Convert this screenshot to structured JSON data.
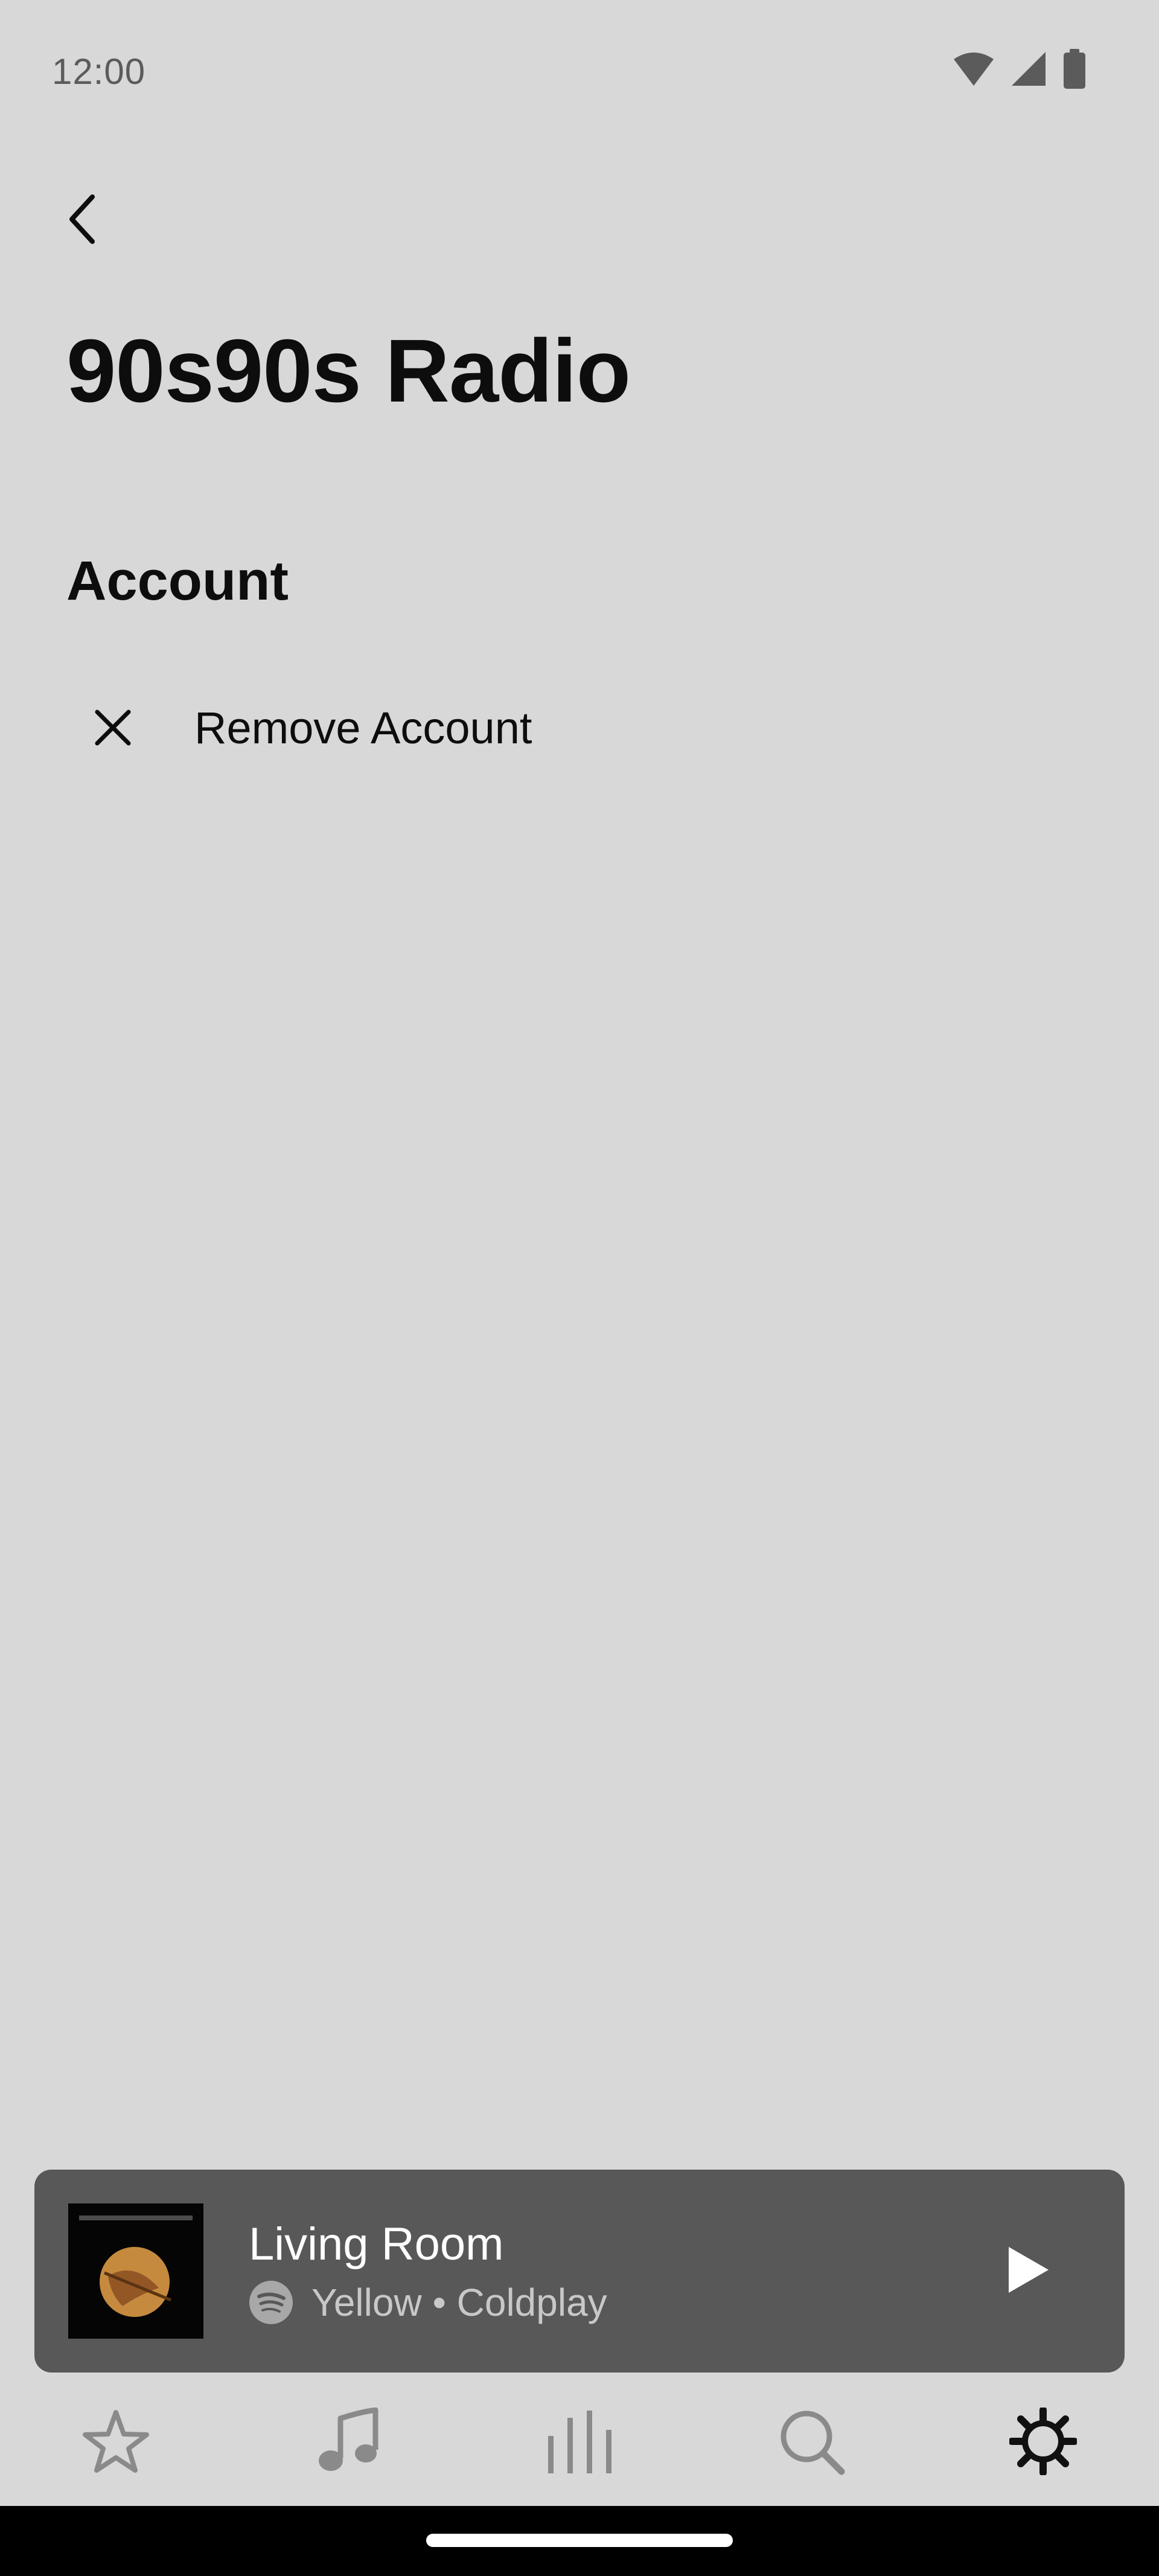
{
  "status_bar": {
    "time": "12:00",
    "icons": [
      "wifi-icon",
      "cell-signal-icon",
      "battery-icon"
    ]
  },
  "header": {
    "back_icon": "chevron-left-icon",
    "title": "90s90s Radio"
  },
  "account_section": {
    "heading": "Account",
    "items": [
      {
        "icon": "close-icon",
        "label": "Remove Account"
      }
    ]
  },
  "now_playing": {
    "room": "Living Room",
    "service_icon": "spotify-icon",
    "track_line": "Yellow • Coldplay",
    "play_icon": "play-icon"
  },
  "bottom_nav": {
    "items": [
      {
        "icon": "star-icon",
        "active": false
      },
      {
        "icon": "music-note-icon",
        "active": false
      },
      {
        "icon": "rooms-bars-icon",
        "active": false
      },
      {
        "icon": "search-icon",
        "active": false
      },
      {
        "icon": "settings-gear-icon",
        "active": true
      }
    ]
  },
  "colors": {
    "background": "#d8d8d8",
    "text_primary": "#0d0d0d",
    "mini_player_bg": "#585858",
    "nav_inactive": "#8a8a8a",
    "nav_active": "#111111"
  }
}
